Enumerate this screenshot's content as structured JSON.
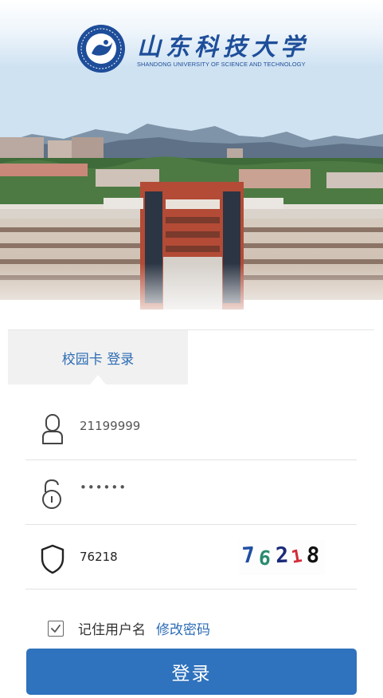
{
  "header": {
    "logo_cn": "山东科技大学",
    "logo_en": "SHANDONG UNIVERSITY OF SCIENCE AND TECHNOLOGY",
    "seal_icon": "university-seal-icon",
    "banner_image": "campus-aerial-photo"
  },
  "tabs": [
    {
      "label": "校园卡 登录",
      "active": true
    }
  ],
  "form": {
    "username": {
      "value": "21199999",
      "icon": "user-icon"
    },
    "password": {
      "value": "••••••",
      "icon": "lock-icon"
    },
    "captcha": {
      "value": "76218",
      "icon": "shield-icon",
      "image_chars": [
        "7",
        "6",
        "2",
        "1",
        "8"
      ]
    }
  },
  "remember": {
    "label": "记住用户名",
    "checked": true
  },
  "change_password_link": "修改密码",
  "login_button": "登录",
  "colors": {
    "accent": "#2f72bd",
    "link": "#2d6db5",
    "logo": "#1e4e9a"
  }
}
